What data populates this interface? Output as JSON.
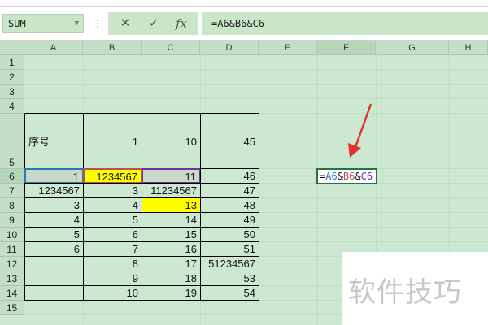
{
  "name_box": "SUM",
  "formula_buttons": {
    "cancel": "✕",
    "enter": "✓",
    "fx": "fx"
  },
  "formula_text": "=A6&B6&C6",
  "columns": [
    "A",
    "B",
    "C",
    "D",
    "E",
    "F",
    "G",
    "H"
  ],
  "rows": [
    "1",
    "2",
    "3",
    "4",
    "5",
    "6",
    "7",
    "8",
    "9",
    "10",
    "11",
    "12",
    "13",
    "14",
    "15"
  ],
  "cells": {
    "A5": "序号",
    "B5": "1",
    "C5": "10",
    "D5": "45",
    "A6": "1",
    "B6": "1234567",
    "C6": "11",
    "D6": "46",
    "A7": "1234567",
    "B7": "3",
    "C7": "11234567",
    "D7": "47",
    "A8": "3",
    "B8": "4",
    "C8": "13",
    "D8": "48",
    "A9": "4",
    "B9": "5",
    "C9": "14",
    "D9": "49",
    "A10": "5",
    "B10": "6",
    "C10": "15",
    "D10": "50",
    "A11": "6",
    "B11": "7",
    "C11": "16",
    "D11": "51",
    "B12": "8",
    "C12": "17",
    "D12": "51234567",
    "B13": "9",
    "C13": "18",
    "D13": "53",
    "B14": "10",
    "C14": "19",
    "D14": "54"
  },
  "edit_cell": {
    "ref": "F6",
    "parts": [
      "=",
      "A6",
      "&",
      "B6",
      "&",
      "C6"
    ]
  },
  "watermark": "软件技巧",
  "colors": {
    "grid_bg": "#cde8d0",
    "highlight": "#ffff00",
    "ref_a": "#2e75b6",
    "ref_b": "#c0504d",
    "ref_c": "#7030a0",
    "arrow": "#e0312a"
  }
}
